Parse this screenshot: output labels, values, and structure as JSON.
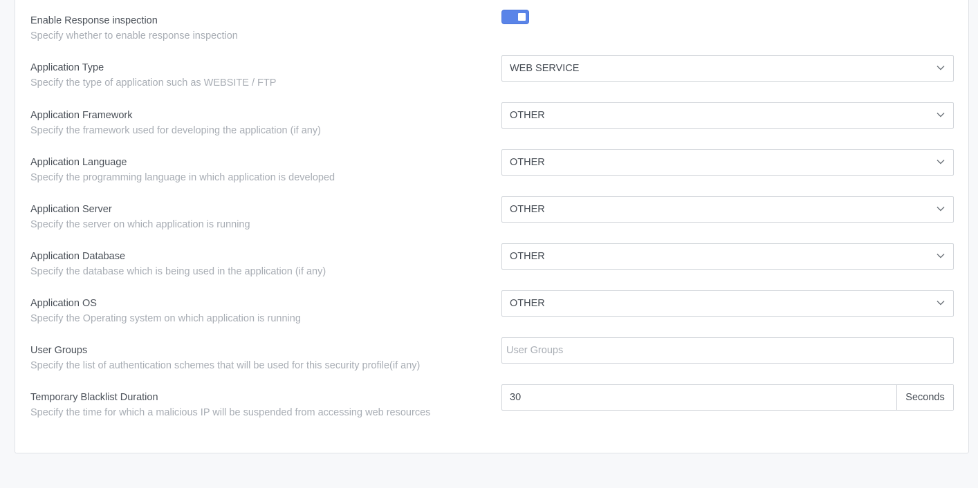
{
  "settings": {
    "response_inspection": {
      "label": "Enable Response inspection",
      "description": "Specify whether to enable response inspection",
      "enabled": true
    },
    "app_type": {
      "label": "Application Type",
      "description": "Specify the type of application such as WEBSITE / FTP",
      "value": "WEB SERVICE"
    },
    "app_framework": {
      "label": "Application Framework",
      "description": "Specify the framework used for developing the application (if any)",
      "value": "OTHER"
    },
    "app_language": {
      "label": "Application Language",
      "description": "Specify the programming language in which application is developed",
      "value": "OTHER"
    },
    "app_server": {
      "label": "Application Server",
      "description": "Specify the server on which application is running",
      "value": "OTHER"
    },
    "app_database": {
      "label": "Application Database",
      "description": "Specify the database which is being used in the application (if any)",
      "value": "OTHER"
    },
    "app_os": {
      "label": "Application OS",
      "description": "Specify the Operating system on which application is running",
      "value": "OTHER"
    },
    "user_groups": {
      "label": "User Groups",
      "description": "Specify the list of authentication schemes that will be used for this security profile(if any)",
      "value": "",
      "placeholder": "User Groups"
    },
    "blacklist_duration": {
      "label": "Temporary Blacklist Duration",
      "description": "Specify the time for which a malicious IP will be suspended from accessing web resources",
      "value": "30",
      "unit": "Seconds"
    }
  },
  "colors": {
    "accent": "#5a84e8",
    "background": "#f7f8fa",
    "card": "#ffffff",
    "muted_text": "#a8adb4"
  },
  "icons": {
    "dropdown": "chevron-down-icon"
  }
}
